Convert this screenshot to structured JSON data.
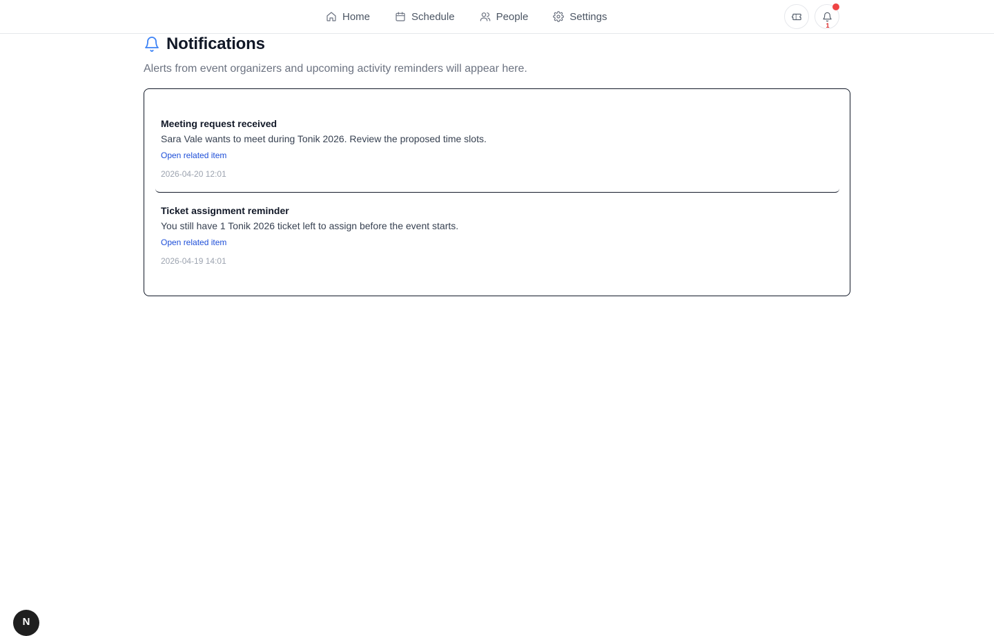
{
  "nav": {
    "items": [
      {
        "label": "Home",
        "icon": "home-icon"
      },
      {
        "label": "Schedule",
        "icon": "calendar-icon"
      },
      {
        "label": "People",
        "icon": "users-icon"
      },
      {
        "label": "Settings",
        "icon": "gear-icon"
      }
    ],
    "notification_count": "1"
  },
  "header": {
    "title": "Notifications",
    "subtitle": "Alerts from event organizers and upcoming activity reminders will appear here."
  },
  "notifications": [
    {
      "title": "Meeting request received",
      "body": "Sara Vale wants to meet during Tonik 2026. Review the proposed time slots.",
      "link": "Open related item",
      "time": "2026-04-20 12:01"
    },
    {
      "title": "Ticket assignment reminder",
      "body": "You still have 1 Tonik 2026 ticket left to assign before the event starts.",
      "link": "Open related item",
      "time": "2026-04-19 14:01"
    }
  ],
  "fab": {
    "label": "N"
  },
  "colors": {
    "accent": "#3b82f6",
    "link": "#1d4ed8",
    "badge": "#ef4444"
  }
}
